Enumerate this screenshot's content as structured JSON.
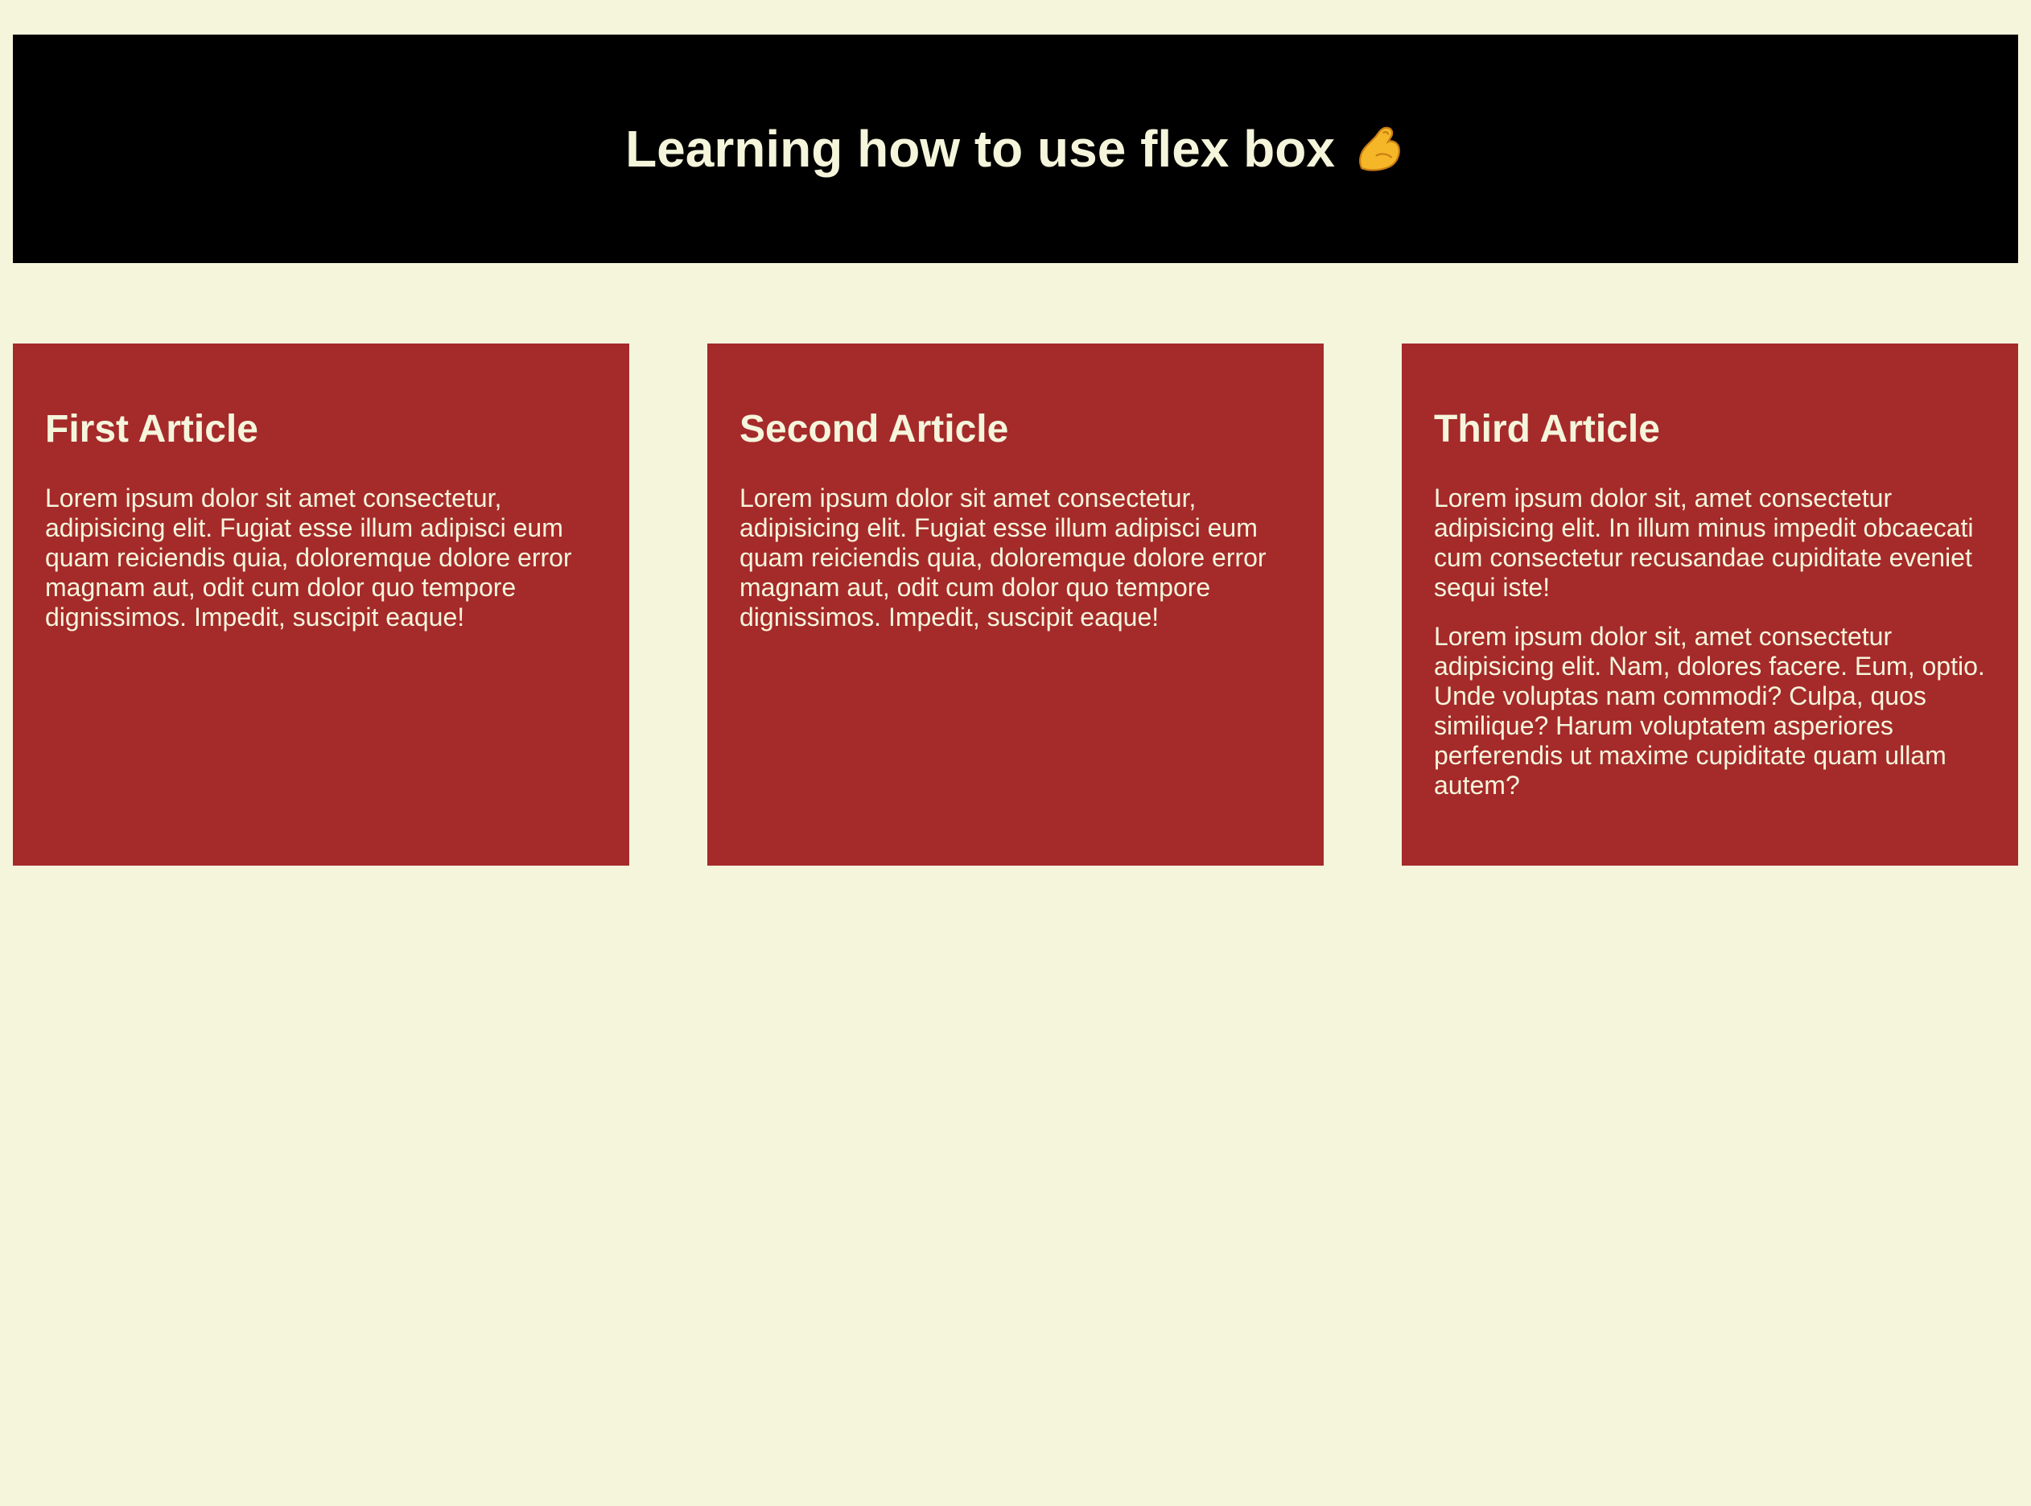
{
  "header": {
    "title": "Learning how to use flex box",
    "emoji_icon": "flexed-biceps-icon"
  },
  "articles": [
    {
      "title": "First Article",
      "paragraphs": [
        "Lorem ipsum dolor sit amet consectetur, adipisicing elit. Fugiat esse illum adipisci eum quam reiciendis quia, doloremque dolore error magnam aut, odit cum dolor quo tempore dignissimos. Impedit, suscipit eaque!"
      ]
    },
    {
      "title": "Second Article",
      "paragraphs": [
        "Lorem ipsum dolor sit amet consectetur, adipisicing elit. Fugiat esse illum adipisci eum quam reiciendis quia, doloremque dolore error magnam aut, odit cum dolor quo tempore dignissimos. Impedit, suscipit eaque!"
      ]
    },
    {
      "title": "Third Article",
      "paragraphs": [
        "Lorem ipsum dolor sit, amet consectetur adipisicing elit. In illum minus impedit obcaecati cum consectetur recusandae cupiditate eveniet sequi iste!",
        "Lorem ipsum dolor sit, amet consectetur adipisicing elit. Nam, dolores facere. Eum, optio. Unde voluptas nam commodi? Culpa, quos similique? Harum voluptatem asperiores perferendis ut maxime cupiditate quam ullam autem?"
      ]
    }
  ],
  "colors": {
    "page_background": "#f5f5dc",
    "header_background": "#000000",
    "article_background": "#a52a2a",
    "text": "#f5f5dc"
  }
}
